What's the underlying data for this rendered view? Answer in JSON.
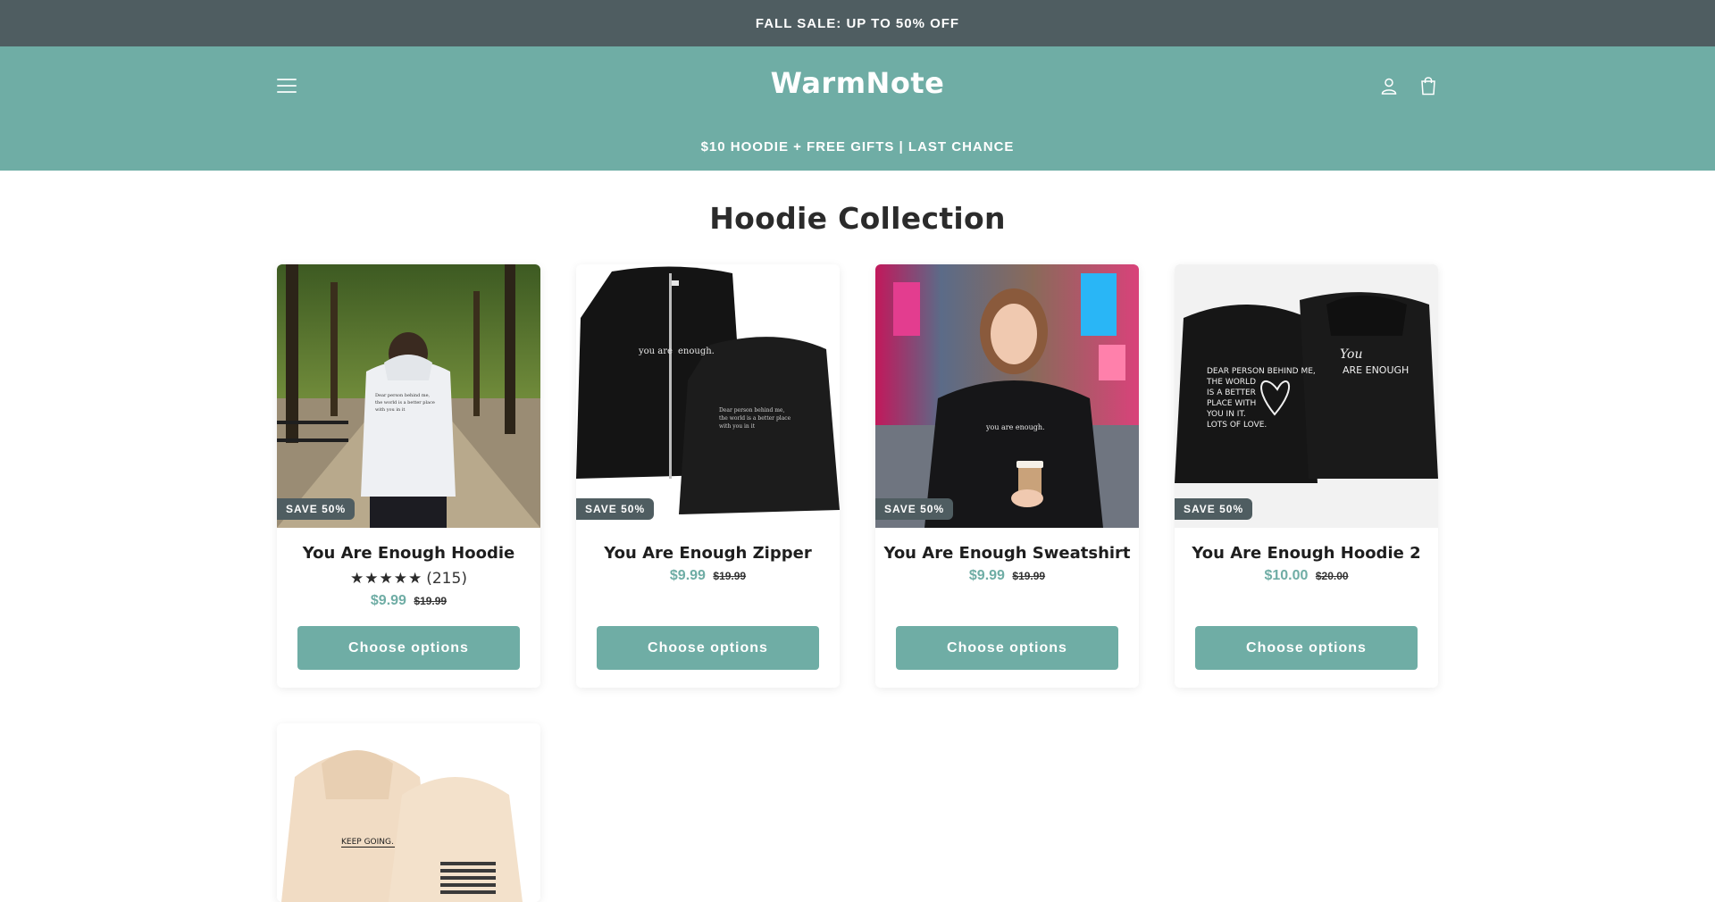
{
  "announcement": {
    "text": " FALL SALE: UP TO 50% OFF "
  },
  "header": {
    "logo": "WarmNote",
    "promo": " $10 HOODIE + FREE GIFTS | LAST CHANCE ",
    "icons": [
      "menu-icon",
      "account-icon",
      "cart-icon"
    ]
  },
  "collection": {
    "title": "Hoodie Collection"
  },
  "products": [
    {
      "title": "You Are Enough Hoodie",
      "badge": "SAVE 50%",
      "stars": "★★★★★",
      "reviews": "(215)",
      "price": "$9.99",
      "compare_price": "$19.99",
      "button": "Choose options"
    },
    {
      "title": "You Are Enough Zipper",
      "badge": "SAVE 50%",
      "price": "$9.99",
      "compare_price": "$19.99",
      "button": "Choose options"
    },
    {
      "title": "You Are Enough Sweatshirt",
      "badge": "SAVE 50%",
      "price": "$9.99",
      "compare_price": "$19.99",
      "button": "Choose options"
    },
    {
      "title": "You Are Enough Hoodie 2",
      "badge": "SAVE 50%",
      "price": "$10.00",
      "compare_price": "$20.00",
      "button": "Choose options"
    }
  ],
  "image_text": {
    "hoodie_back": "Dear person behind me, the world is a better place with you in it",
    "zipper_front": "you are enough.",
    "sweatshirt_front": "you are enough.",
    "hoodie2_front": "DEAR PERSON BEHIND ME, THE WORLD IS A BETTER PLACE WITH YOU IN IT. LOTS OF LOVE.",
    "hoodie2_back": "You ARE ENOUGH",
    "keep_going": "KEEP GOING."
  },
  "colors": {
    "announcement_bg": "#4f5d61",
    "header_bg": "#6fada5",
    "accent": "#6fada5",
    "badge_bg": "#4f5d61"
  }
}
